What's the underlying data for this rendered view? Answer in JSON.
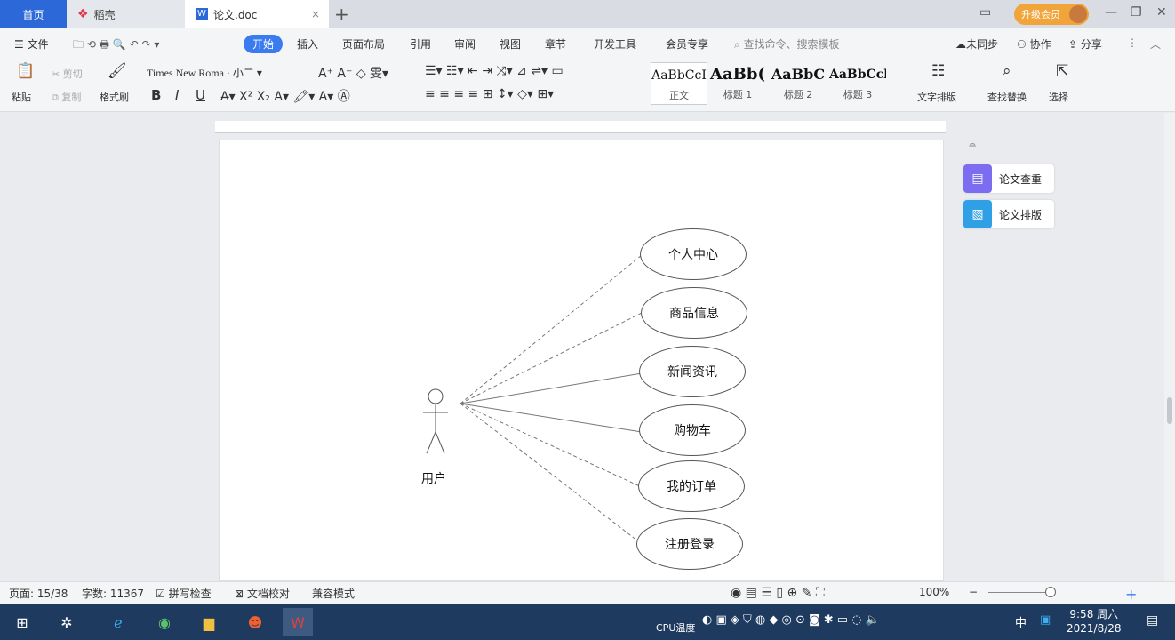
{
  "tabs": {
    "home": "首页",
    "daoke": "稻壳",
    "doc": "论文.doc",
    "new": "+",
    "doc_close": "×"
  },
  "vip_label": "升级会员",
  "menu": {
    "file": "文件",
    "items": [
      "开始",
      "插入",
      "页面布局",
      "引用",
      "审阅",
      "视图",
      "章节",
      "开发工具",
      "会员专享"
    ],
    "search": "查找命令、搜索模板",
    "unsync": "未同步",
    "collab": "协作",
    "share": "分享"
  },
  "ribbon": {
    "paste": "粘贴",
    "cut": "剪切",
    "copy": "复制",
    "format_painter": "格式刷",
    "font_name": "Times New Roma",
    "font_size": "小二",
    "bold": "B",
    "italic": "I",
    "underline": "U",
    "styles": [
      {
        "sample": "AaBbCcI",
        "label": "正文"
      },
      {
        "sample": "AaBb(",
        "label": "标题 1"
      },
      {
        "sample": "AaBbC",
        "label": "标题 2"
      },
      {
        "sample": "AaBbCcl",
        "label": "标题 3"
      }
    ],
    "text_layout": "文字排版",
    "find_replace": "查找替换",
    "select": "选择"
  },
  "side_panel": {
    "check": "论文查重",
    "layout": "论文排版"
  },
  "diagram": {
    "actor": "用户",
    "use_cases": [
      "个人中心",
      "商品信息",
      "新闻资讯",
      "购物车",
      "我的订单",
      "注册登录"
    ]
  },
  "status": {
    "page": "页面: 15/38",
    "words": "字数: 11367",
    "spell": "拼写检查",
    "proof": "文档校对",
    "compat": "兼容模式",
    "zoom": "100%"
  },
  "taskbar": {
    "time": "9:58 周六",
    "date": "2021/8/28",
    "cpu": "CPU温度",
    "ime": "中"
  },
  "colors": {
    "accent": "#3a7bf0",
    "taskbar": "#1f3a5f",
    "vip": "#f0a43a"
  }
}
